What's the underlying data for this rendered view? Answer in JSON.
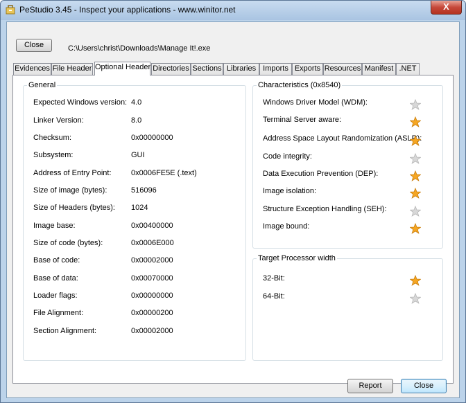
{
  "window": {
    "title": "PeStudio 3.45 - Inspect your applications - www.winitor.net",
    "close_glyph": "X"
  },
  "top": {
    "close_label": "Close",
    "file_path": "C:\\Users\\christ\\Downloads\\Manage It!.exe"
  },
  "tabs": [
    "Evidences",
    "File Header",
    "Optional Header",
    "Directories",
    "Sections",
    "Libraries",
    "Imports",
    "Exports",
    "Resources",
    "Manifest",
    ".NET"
  ],
  "active_tab": "Optional Header",
  "general": {
    "title": "General",
    "rows": [
      {
        "label": "Expected Windows version:",
        "value": "4.0"
      },
      {
        "label": "Linker Version:",
        "value": "8.0"
      },
      {
        "label": "Checksum:",
        "value": "0x00000000"
      },
      {
        "label": "Subsystem:",
        "value": "GUI"
      },
      {
        "label": "Address of Entry Point:",
        "value": "0x0006FE5E (.text)"
      },
      {
        "label": "Size of image (bytes):",
        "value": "516096"
      },
      {
        "label": "Size of Headers (bytes):",
        "value": "1024"
      },
      {
        "label": "Image base:",
        "value": "0x00400000"
      },
      {
        "label": "Size of code (bytes):",
        "value": "0x0006E000"
      },
      {
        "label": "Base of code:",
        "value": "0x00002000"
      },
      {
        "label": "Base of data:",
        "value": "0x00070000"
      },
      {
        "label": "Loader flags:",
        "value": "0x00000000"
      },
      {
        "label": "File Alignment:",
        "value": "0x00000200"
      },
      {
        "label": "Section Alignment:",
        "value": "0x00002000"
      }
    ]
  },
  "characteristics": {
    "title": "Characteristics (0x8540)",
    "rows": [
      {
        "label": "Windows Driver Model (WDM):",
        "star": "star-empty-icon"
      },
      {
        "label": "Terminal Server aware:",
        "star": "star-filled-icon"
      },
      {
        "label": "Address Space Layout Randomization (ASLR):",
        "star": "star-filled-icon"
      },
      {
        "label": "Code integrity:",
        "star": "star-empty-icon"
      },
      {
        "label": "Data Execution Prevention (DEP):",
        "star": "star-filled-icon"
      },
      {
        "label": "Image isolation:",
        "star": "star-filled-icon"
      },
      {
        "label": "Structure Exception Handling (SEH):",
        "star": "star-empty-icon"
      },
      {
        "label": "Image bound:",
        "star": "star-filled-icon"
      }
    ]
  },
  "processor": {
    "title": "Target Processor width",
    "rows": [
      {
        "label": "32-Bit:",
        "star": "star-filled-icon"
      },
      {
        "label": "64-Bit:",
        "star": "star-empty-icon"
      }
    ]
  },
  "footer": {
    "report_label": "Report",
    "close_label": "Close"
  },
  "colors": {
    "star_filled": "#f5a623",
    "star_empty": "#d8d8d8",
    "titlebar": "#b9cfe8"
  }
}
